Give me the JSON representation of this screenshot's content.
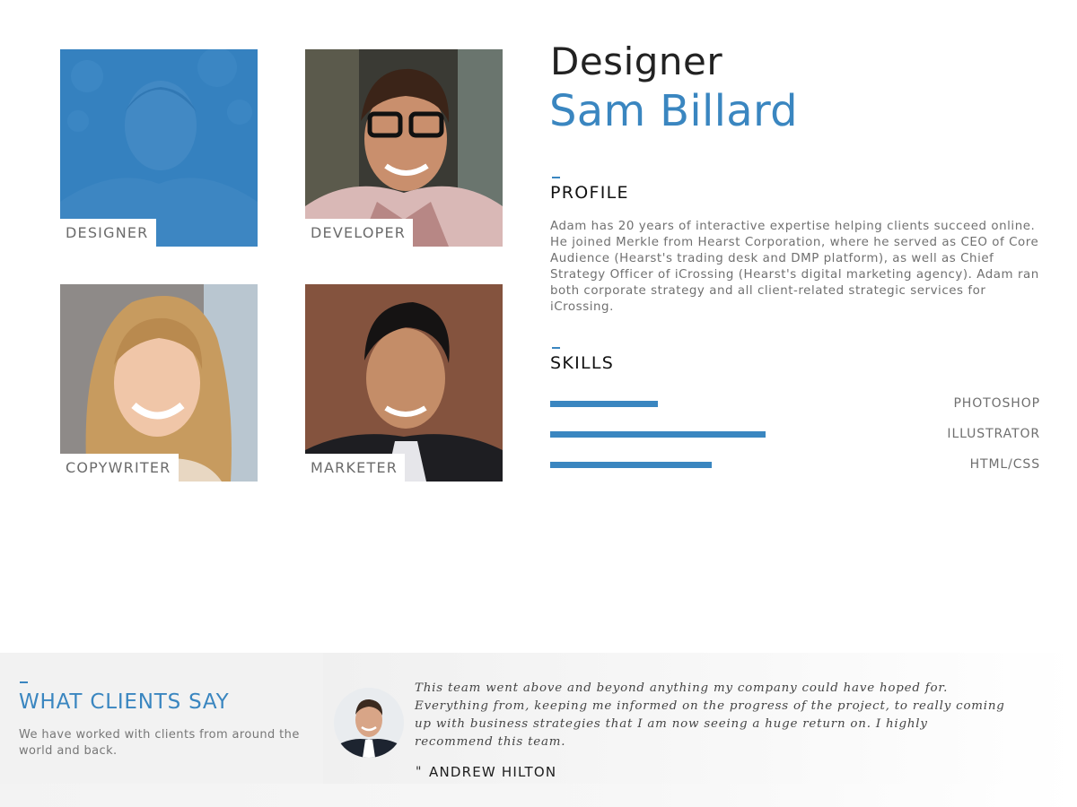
{
  "team": [
    {
      "label": "DESIGNER",
      "active": true
    },
    {
      "label": "DEVELOPER",
      "active": false
    },
    {
      "label": "COPYWRITER",
      "active": false
    },
    {
      "label": "MARKETER",
      "active": false
    }
  ],
  "profile": {
    "role": "Designer",
    "name": "Sam Billard",
    "section_profile": "PROFILE",
    "bio": "Adam has 20 years of interactive expertise helping clients succeed online. He joined Merkle from Hearst Corporation, where he served as CEO of Core Audience (Hearst's trading desk and DMP platform), as well as Chief Strategy Officer of iCrossing (Hearst's digital marketing agency). Adam ran both corporate strategy and all client-related strategic services for iCrossing.",
    "section_skills": "SKILLS",
    "skills": [
      {
        "label": "PHOTOSHOP",
        "level": 0.22
      },
      {
        "label": "ILLUSTRATOR",
        "level": 0.44
      },
      {
        "label": "HTML/CSS",
        "level": 0.33
      }
    ]
  },
  "clients": {
    "heading": "WHAT CLIENTS SAY",
    "subtext": "We have worked with clients from around the world and back.",
    "quote": "This team went above and beyond anything my company could have hoped for. Everything from, keeping me informed on the progress of the project, to really coming up with business strategies that I am now seeing a huge return on. I highly recommend this team.",
    "quote_mark": "\"",
    "author": "ANDREW HILTON"
  },
  "colors": {
    "accent": "#3a86c0",
    "text_muted": "#707070"
  }
}
